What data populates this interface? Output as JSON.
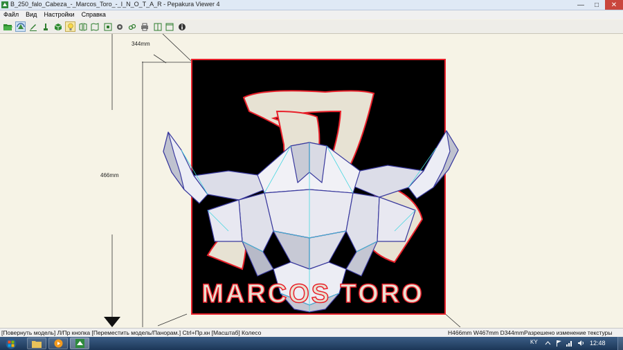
{
  "window": {
    "title": "B_250_falo_Cabeza_-_Marcos_Toro_-_I_N_O_T_A_R - Pepakura Viewer 4",
    "minimize": "—",
    "maximize": "□",
    "close": "✕"
  },
  "menu": [
    {
      "label": "Файл"
    },
    {
      "label": "Вид"
    },
    {
      "label": "Настройки"
    },
    {
      "label": "Справка"
    }
  ],
  "toolbar": {
    "buttons": [
      {
        "icon": "open-folder-icon"
      },
      {
        "icon": "rotate-model-icon",
        "state": "pressed"
      },
      {
        "icon": "edit-pen-icon"
      },
      {
        "icon": "paint-icon"
      },
      {
        "icon": "cube-icon"
      },
      {
        "icon": "light-bulb-icon",
        "state": "active"
      },
      {
        "icon": "unfold-icon"
      },
      {
        "icon": "map-icon"
      },
      {
        "icon": "grid-icon"
      },
      {
        "icon": "fit-view-icon"
      },
      {
        "icon": "settings-gear-icon"
      },
      {
        "icon": "link-icon"
      },
      {
        "icon": "print-icon"
      },
      {
        "icon": "split-view-icon"
      },
      {
        "icon": "single-view-icon"
      },
      {
        "icon": "info-icon"
      }
    ]
  },
  "viewport": {
    "depth_label": "344mm",
    "height_label": "466mm",
    "logo_text": "MARCOS TORO",
    "colors": {
      "background": "#f6f3e6",
      "plate": "#000000",
      "outline": "#e8202a",
      "mesh": "#3a3a9e",
      "seam": "#45d6e0"
    }
  },
  "statusbar": {
    "left": "[Повернуть модель] Л/Пр кнопка [Переместить модель/Панорам.] Ctrl+Пр.кн [Масштаб] Колесо",
    "right": "H466mm W467mm D344mmРазрешено изменение текстуры"
  },
  "taskbar": {
    "language": "KY",
    "clock": "12:48"
  }
}
